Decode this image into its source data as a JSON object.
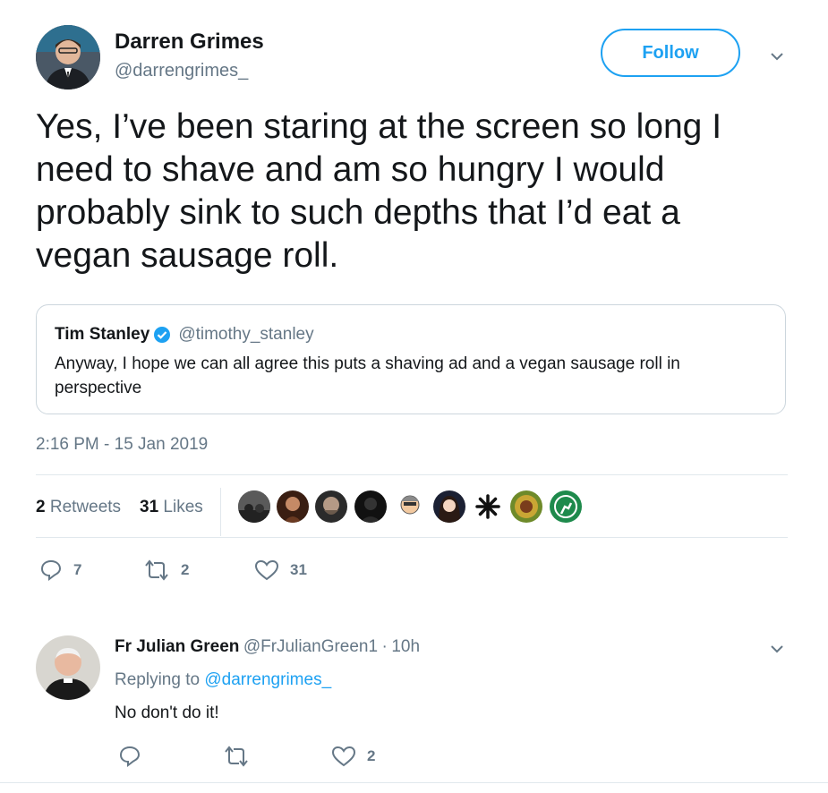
{
  "tweet": {
    "author_name": "Darren Grimes",
    "author_handle": "@darrengrimes_",
    "follow_label": "Follow",
    "text": "Yes, I’ve been staring at the screen so long I need to shave and am so hungry I would probably sink to such depths that I’d eat a vegan sausage roll.",
    "timestamp": "2:16 PM - 15 Jan 2019",
    "retweets_count": "2",
    "retweets_label": "Retweets",
    "likes_count": "31",
    "likes_label": "Likes",
    "reply_count": "7",
    "retweet_action_count": "2",
    "like_action_count": "31"
  },
  "quoted": {
    "author_name": "Tim Stanley",
    "author_handle": "@timothy_stanley",
    "text": "Anyway, I hope we can all agree this puts a shaving ad and a vegan sausage roll in perspective"
  },
  "reply": {
    "author_name": "Fr Julian Green",
    "author_handle": "@FrJulianGreen1",
    "separator": "·",
    "time": "10h",
    "replying_prefix": "Replying to",
    "replying_to": "@darrengrimes_",
    "text": "No don't do it!",
    "like_count": "2"
  },
  "icons": {
    "verified": "verified-badge-icon",
    "reply": "reply-icon",
    "retweet": "retweet-icon",
    "like": "heart-icon",
    "caret": "chevron-down-icon"
  },
  "colors": {
    "accent": "#1da1f2",
    "text": "#14171a",
    "muted": "#657786",
    "divider": "#e1e8ed"
  }
}
